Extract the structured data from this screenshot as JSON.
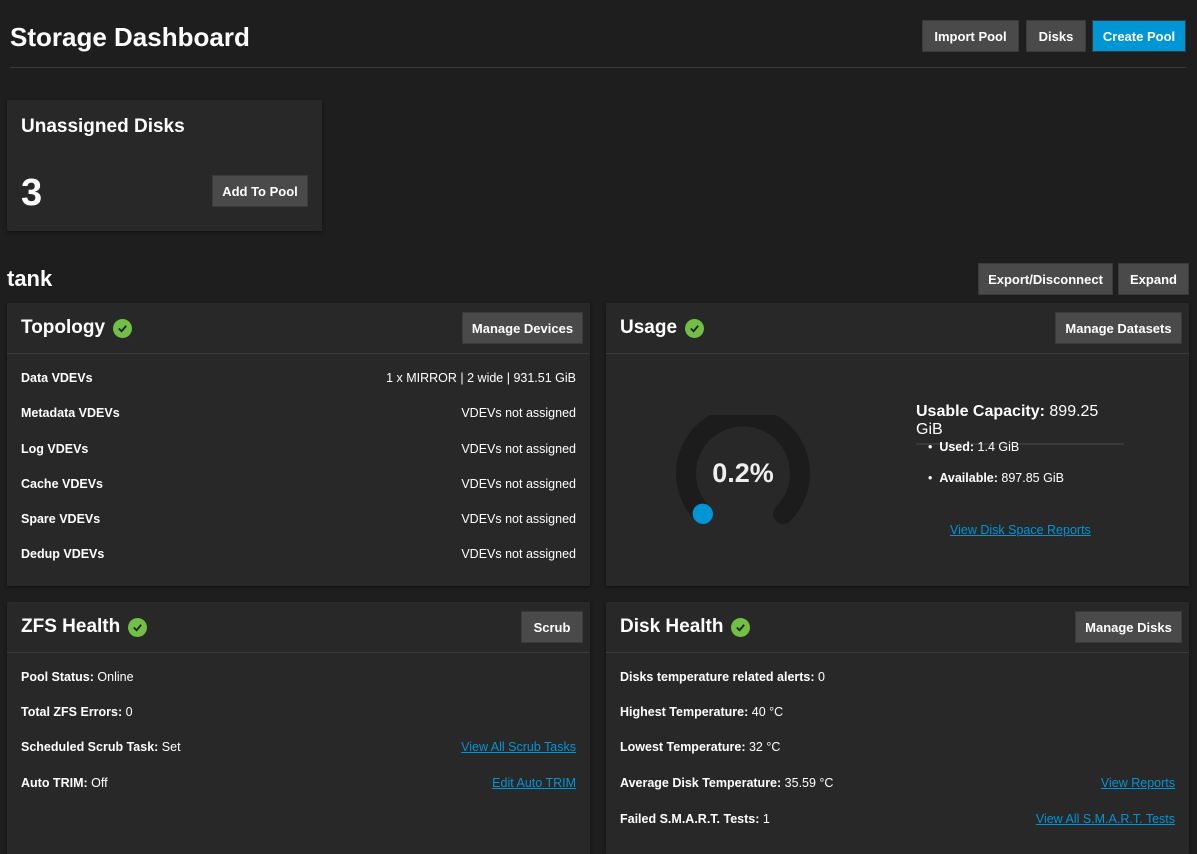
{
  "header": {
    "title": "Storage Dashboard",
    "import_pool": "Import Pool",
    "disks": "Disks",
    "create_pool": "Create Pool"
  },
  "unassigned": {
    "title": "Unassigned Disks",
    "count": "3",
    "add_to_pool": "Add To Pool"
  },
  "pool": {
    "name": "tank",
    "export": "Export/Disconnect",
    "expand": "Expand"
  },
  "topology": {
    "title": "Topology",
    "button": "Manage Devices",
    "rows": [
      {
        "label": "Data VDEVs",
        "value": "1 x MIRROR | 2 wide | 931.51 GiB"
      },
      {
        "label": "Metadata VDEVs",
        "value": "VDEVs not assigned"
      },
      {
        "label": "Log VDEVs",
        "value": "VDEVs not assigned"
      },
      {
        "label": "Cache VDEVs",
        "value": "VDEVs not assigned"
      },
      {
        "label": "Spare VDEVs",
        "value": "VDEVs not assigned"
      },
      {
        "label": "Dedup VDEVs",
        "value": "VDEVs not assigned"
      }
    ]
  },
  "usage": {
    "title": "Usage",
    "button": "Manage Datasets",
    "percent_label": "0.2%",
    "percent": 0.2,
    "capacity_label": "Usable Capacity:",
    "capacity": "899.25 GiB",
    "used_label": "Used:",
    "used": "1.4 GiB",
    "available_label": "Available:",
    "available": "897.85 GiB",
    "link": "View Disk Space Reports"
  },
  "zfs": {
    "title": "ZFS Health",
    "button": "Scrub",
    "rows": [
      {
        "label": "Pool Status:",
        "value": "Online"
      },
      {
        "label": "Total ZFS Errors:",
        "value": "0"
      },
      {
        "label": "Scheduled Scrub Task:",
        "value": "Set",
        "link": "View All Scrub Tasks"
      },
      {
        "label": "Auto TRIM:",
        "value": "Off",
        "link": "Edit Auto TRIM"
      }
    ]
  },
  "disk": {
    "title": "Disk Health",
    "button": "Manage Disks",
    "rows": [
      {
        "label": "Disks temperature related alerts:",
        "value": "0"
      },
      {
        "label": "Highest Temperature:",
        "value": "40 °C"
      },
      {
        "label": "Lowest Temperature:",
        "value": "32 °C"
      },
      {
        "label": "Average Disk Temperature:",
        "value": "35.59 °C",
        "link": "View Reports"
      },
      {
        "label": "Failed S.M.A.R.T. Tests:",
        "value": "1",
        "link": "View All S.M.A.R.T. Tests"
      }
    ]
  },
  "colors": {
    "accent": "#0095d5",
    "ok": "#71bf44"
  }
}
